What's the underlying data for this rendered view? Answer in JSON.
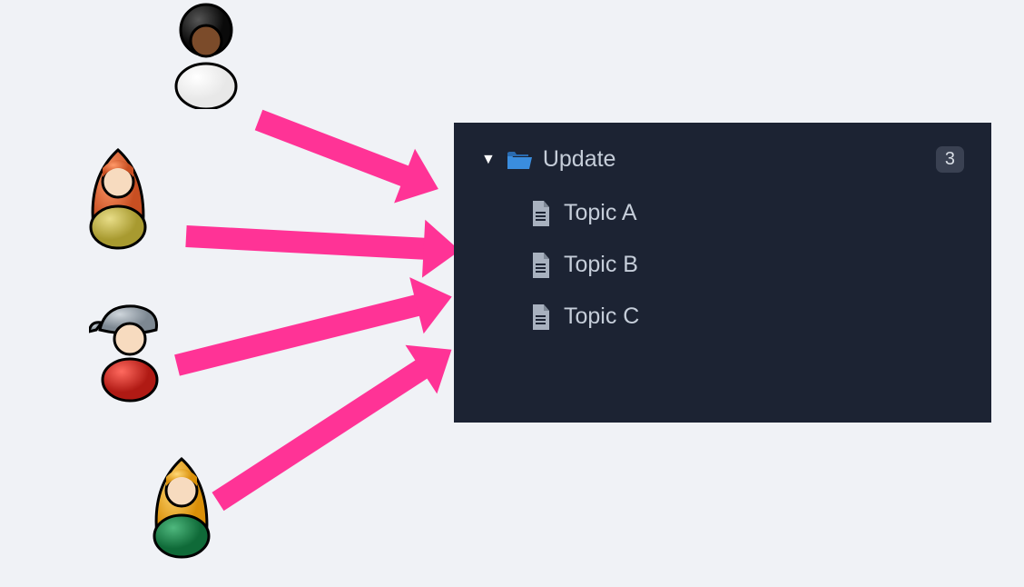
{
  "people": [
    {
      "hair": "#1b1b1b",
      "skin": "#7b4b2a",
      "body": "#ffffff"
    },
    {
      "hair": "#e06a3b",
      "skin": "#f7dbbf",
      "body": "#c7b84b"
    },
    {
      "hair": "#9aa2ac",
      "skin": "#f7dbbf",
      "body": "#d6302c"
    },
    {
      "hair": "#f2b22a",
      "skin": "#f7dbbf",
      "body": "#1e8a4e"
    }
  ],
  "folder": {
    "label": "Update",
    "count": "3"
  },
  "topics": [
    {
      "label": "Topic A"
    },
    {
      "label": "Topic B"
    },
    {
      "label": "Topic C"
    }
  ],
  "colors": {
    "arrow": "#ff3396",
    "panel_bg": "#1c2333",
    "folder_icon": "#3a8dde"
  }
}
